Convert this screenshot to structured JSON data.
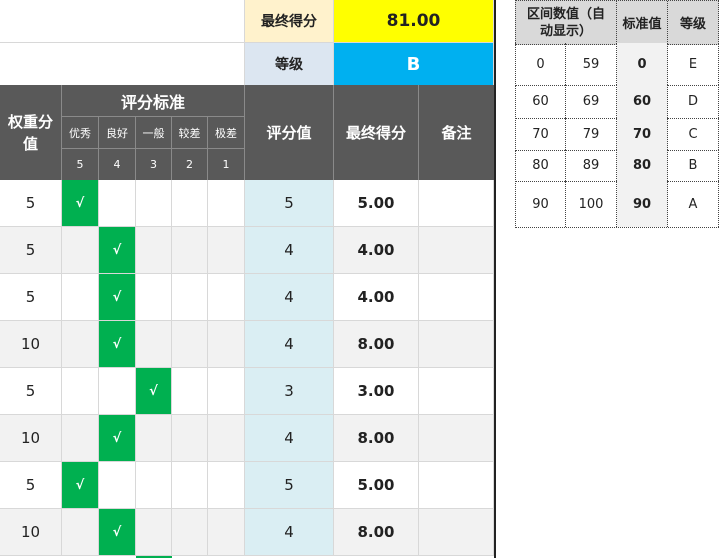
{
  "summary": {
    "final_score_label": "最终得分",
    "final_score_value": "81.00",
    "grade_label": "等级",
    "grade_value": "B"
  },
  "header": {
    "weight": "权重分值",
    "criteria": "评分标准",
    "levels": [
      "优秀",
      "良好",
      "一般",
      "较差",
      "极差"
    ],
    "level_points": [
      "5",
      "4",
      "3",
      "2",
      "1"
    ],
    "score": "评分值",
    "final": "最终得分",
    "note": "备注"
  },
  "check_mark": "√",
  "rows": [
    {
      "weight": "5",
      "check_index": 0,
      "score": "5",
      "final": "5.00",
      "note": ""
    },
    {
      "weight": "5",
      "check_index": 1,
      "score": "4",
      "final": "4.00",
      "note": ""
    },
    {
      "weight": "5",
      "check_index": 1,
      "score": "4",
      "final": "4.00",
      "note": ""
    },
    {
      "weight": "10",
      "check_index": 1,
      "score": "4",
      "final": "8.00",
      "note": ""
    },
    {
      "weight": "5",
      "check_index": 2,
      "score": "3",
      "final": "3.00",
      "note": ""
    },
    {
      "weight": "10",
      "check_index": 1,
      "score": "4",
      "final": "8.00",
      "note": ""
    },
    {
      "weight": "5",
      "check_index": 0,
      "score": "5",
      "final": "5.00",
      "note": ""
    },
    {
      "weight": "10",
      "check_index": 1,
      "score": "4",
      "final": "8.00",
      "note": ""
    }
  ],
  "grade_table": {
    "headers": [
      "区间数值（自动显示）",
      "标准值",
      "等级"
    ],
    "rows": [
      {
        "low": "0",
        "high": "59",
        "std": "0",
        "grade": "E"
      },
      {
        "low": "60",
        "high": "69",
        "std": "60",
        "grade": "D"
      },
      {
        "low": "70",
        "high": "79",
        "std": "70",
        "grade": "C"
      },
      {
        "low": "80",
        "high": "89",
        "std": "80",
        "grade": "B"
      },
      {
        "low": "90",
        "high": "100",
        "std": "90",
        "grade": "A"
      }
    ]
  },
  "colors": {
    "check_green": "#00b050",
    "score_blue": "#daeef3",
    "final_yellow": "#ffff00",
    "grade_cyan": "#00b0f0",
    "label_cream": "#fff2cc",
    "label_lightblue": "#dce6f1",
    "header_dark": "#595959"
  }
}
